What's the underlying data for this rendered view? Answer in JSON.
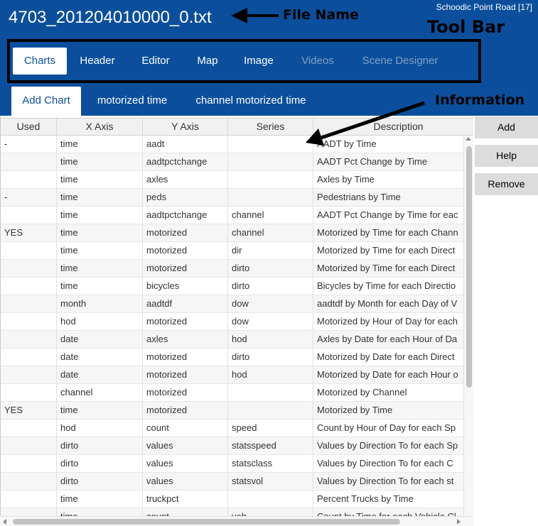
{
  "header": {
    "file_name": "4703_201204010000_0.txt",
    "location": "Schoodic Point Road [17]"
  },
  "annotations": {
    "file_name": "File Name",
    "tool_bar": "Tool Bar",
    "information": "Information"
  },
  "toolbar": {
    "tabs": [
      {
        "label": "Charts",
        "state": "active"
      },
      {
        "label": "Header",
        "state": "enabled"
      },
      {
        "label": "Editor",
        "state": "enabled"
      },
      {
        "label": "Map",
        "state": "enabled"
      },
      {
        "label": "Image",
        "state": "enabled"
      },
      {
        "label": "Videos",
        "state": "disabled"
      },
      {
        "label": "Scene Designer",
        "state": "disabled"
      }
    ]
  },
  "subtabs": [
    {
      "label": "Add Chart",
      "state": "active"
    },
    {
      "label": "motorized time",
      "state": "enabled"
    },
    {
      "label": "channel motorized time",
      "state": "enabled"
    }
  ],
  "table": {
    "columns": [
      "Used",
      "X Axis",
      "Y Axis",
      "Series",
      "Description"
    ],
    "rows": [
      [
        "-",
        "time",
        "aadt",
        "",
        "AADT by Time"
      ],
      [
        "",
        "time",
        "aadtpctchange",
        "",
        "AADT Pct Change by Time"
      ],
      [
        "",
        "time",
        "axles",
        "",
        "Axles by Time"
      ],
      [
        "-",
        "time",
        "peds",
        "",
        "Pedestrians by Time"
      ],
      [
        "",
        "time",
        "aadtpctchange",
        "channel",
        "AADT Pct Change by Time for eac"
      ],
      [
        "YES",
        "time",
        "motorized",
        "channel",
        "Motorized by Time for each Chann"
      ],
      [
        "",
        "time",
        "motorized",
        "dir",
        "Motorized by Time for each Direct"
      ],
      [
        "",
        "time",
        "motorized",
        "dirto",
        "Motorized by Time for each Direct"
      ],
      [
        "",
        "time",
        "bicycles",
        "dirto",
        "Bicycles by Time for each Directio"
      ],
      [
        "",
        "month",
        "aadtdf",
        "dow",
        "aadtdf by Month for each Day of V"
      ],
      [
        "",
        "hod",
        "motorized",
        "dow",
        "Motorized by Hour of Day for each"
      ],
      [
        "",
        "date",
        "axles",
        "hod",
        "Axles by Date for each Hour of Da"
      ],
      [
        "",
        "date",
        "motorized",
        "dirto",
        "Motorized by Date for each Direct"
      ],
      [
        "",
        "date",
        "motorized",
        "hod",
        "Motorized by Date for each Hour o"
      ],
      [
        "",
        "channel",
        "motorized",
        "",
        "Motorized by Channel"
      ],
      [
        "YES",
        "time",
        "motorized",
        "",
        "Motorized by Time"
      ],
      [
        "",
        "hod",
        "count",
        "speed",
        "Count by Hour of Day for each Sp"
      ],
      [
        "",
        "dirto",
        "values",
        "statsspeed",
        "Values by Direction To for each Sp"
      ],
      [
        "",
        "dirto",
        "values",
        "statsclass",
        "Values by Direction To for each C"
      ],
      [
        "",
        "dirto",
        "values",
        "statsvol",
        "Values by Direction To for each st"
      ],
      [
        "",
        "time",
        "truckpct",
        "",
        "Percent Trucks by Time"
      ],
      [
        "",
        "time",
        "count",
        "veh",
        "Count by Time for each Vehicle Cl"
      ]
    ]
  },
  "actions": {
    "add": "Add",
    "help": "Help",
    "remove": "Remove"
  },
  "colors": {
    "header_blue": "#0b4f9c",
    "disabled_tab": "#7f9fc5",
    "button_gray": "#dcdcdc"
  }
}
